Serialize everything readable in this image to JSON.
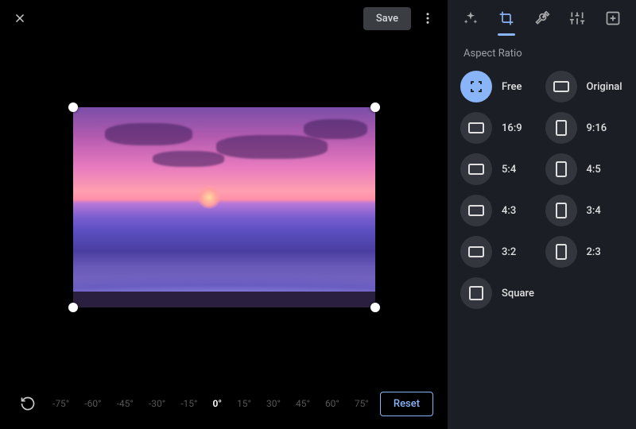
{
  "toolbar": {
    "save_label": "Save"
  },
  "rotation": {
    "current": "0°",
    "ticks": [
      "-75°",
      "-60°",
      "-45°",
      "-30°",
      "-15°",
      "0°",
      "15°",
      "30°",
      "45°",
      "60°",
      "75°"
    ]
  },
  "reset_label": "Reset",
  "panel": {
    "section_title": "Aspect Ratio",
    "active_tab": "crop",
    "ratios": [
      {
        "id": "free",
        "label": "Free",
        "shape": "free",
        "selected": true
      },
      {
        "id": "original",
        "label": "Original",
        "shape": "landscape",
        "selected": false
      },
      {
        "id": "16-9",
        "label": "16:9",
        "shape": "landscape",
        "selected": false
      },
      {
        "id": "9-16",
        "label": "9:16",
        "shape": "portrait",
        "selected": false
      },
      {
        "id": "5-4",
        "label": "5:4",
        "shape": "landscape",
        "selected": false
      },
      {
        "id": "4-5",
        "label": "4:5",
        "shape": "portrait",
        "selected": false
      },
      {
        "id": "4-3",
        "label": "4:3",
        "shape": "landscape",
        "selected": false
      },
      {
        "id": "3-4",
        "label": "3:4",
        "shape": "portrait",
        "selected": false
      },
      {
        "id": "3-2",
        "label": "3:2",
        "shape": "landscape",
        "selected": false
      },
      {
        "id": "2-3",
        "label": "2:3",
        "shape": "portrait",
        "selected": false
      },
      {
        "id": "square",
        "label": "Square",
        "shape": "square",
        "selected": false
      }
    ]
  }
}
